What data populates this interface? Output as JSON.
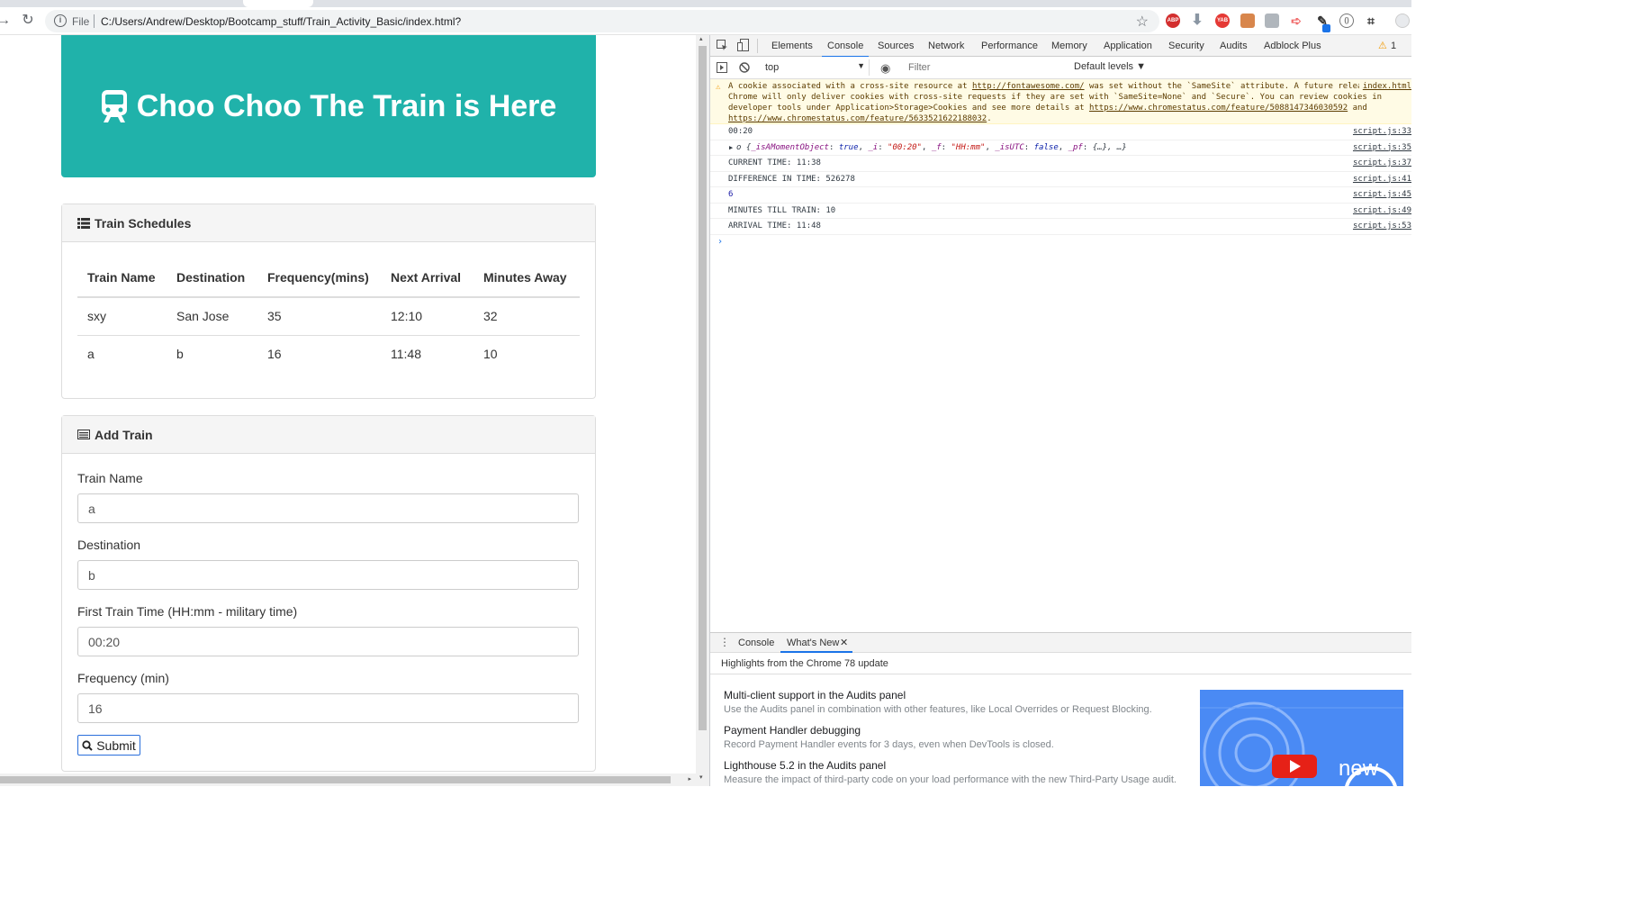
{
  "browser": {
    "file_label": "File",
    "url": "C:/Users/Andrew/Desktop/Bootcamp_stuff/Train_Activity_Basic/index.html?"
  },
  "page": {
    "title": "Choo Choo The Train is Here",
    "schedule": {
      "heading": "Train Schedules",
      "columns": [
        "Train Name",
        "Destination",
        "Frequency(mins)",
        "Next Arrival",
        "Minutes Away"
      ],
      "rows": [
        [
          "sxy",
          "San Jose",
          "35",
          "12:10",
          "32"
        ],
        [
          "a",
          "b",
          "16",
          "11:48",
          "10"
        ]
      ]
    },
    "add_train": {
      "heading": "Add Train",
      "fields": [
        {
          "label": "Train Name",
          "value": "a"
        },
        {
          "label": "Destination",
          "value": "b"
        },
        {
          "label": "First Train Time (HH:mm - military time)",
          "value": "00:20"
        },
        {
          "label": "Frequency (min)",
          "value": "16"
        }
      ],
      "submit_label": "Submit"
    }
  },
  "devtools": {
    "tabs": [
      "Elements",
      "Console",
      "Sources",
      "Network",
      "Performance",
      "Memory",
      "Application",
      "Security",
      "Audits",
      "Adblock Plus"
    ],
    "warning_count": "1",
    "context": "top",
    "filter_placeholder": "Filter",
    "levels": "Default levels ▼",
    "warning": {
      "part1": "A cookie associated with a cross-site resource at ",
      "link1": "http://fontawesome.com/",
      "part2": " was set without the `SameSite` attribute. A future release of Chrome will only deliver cookies with cross-site requests if they are set with `SameSite=None` and `Secure`. You can review cookies in developer tools under Application>Storage>Cookies and see more details at ",
      "link2": "https://www.chromestatus.com/feature/5088147346030592",
      "part3": " and ",
      "link3": "https://www.chromestatus.com/feature/5633521622188032",
      "part4": ".",
      "source": "index.html"
    },
    "log": [
      {
        "text": "00:20",
        "source": "script.js:33"
      },
      {
        "text": "CURRENT TIME: 11:38",
        "source": "script.js:37"
      },
      {
        "text": "DIFFERENCE IN TIME: 526278",
        "source": "script.js:41"
      },
      {
        "text": "6",
        "source": "script.js:45"
      },
      {
        "text": "MINUTES TILL TRAIN: 10",
        "source": "script.js:49"
      },
      {
        "text": "ARRIVAL TIME: 11:48",
        "source": "script.js:53"
      }
    ],
    "object_log": {
      "prefix": "o {",
      "k1": "_isAMomentObject",
      "v1": "true",
      "k2": "_i",
      "v2": "\"00:20\"",
      "k3": "_f",
      "v3": "\"HH:mm\"",
      "k4": "_isUTC",
      "v4": "false",
      "k5": "_pf",
      "v5": "{…}",
      "suffix": ", …}",
      "source": "script.js:35"
    },
    "drawer": {
      "tabs": [
        "Console",
        "What's New"
      ],
      "subtitle": "Highlights from the Chrome 78 update",
      "items": [
        {
          "title": "Multi-client support in the Audits panel",
          "desc": "Use the Audits panel in combination with other features, like Local Overrides or Request Blocking."
        },
        {
          "title": "Payment Handler debugging",
          "desc": "Record Payment Handler events for 3 days, even when DevTools is closed."
        },
        {
          "title": "Lighthouse 5.2 in the Audits panel",
          "desc": "Measure the impact of third-party code on your load performance with the new Third-Party Usage audit."
        }
      ],
      "promo_text": "new"
    }
  }
}
